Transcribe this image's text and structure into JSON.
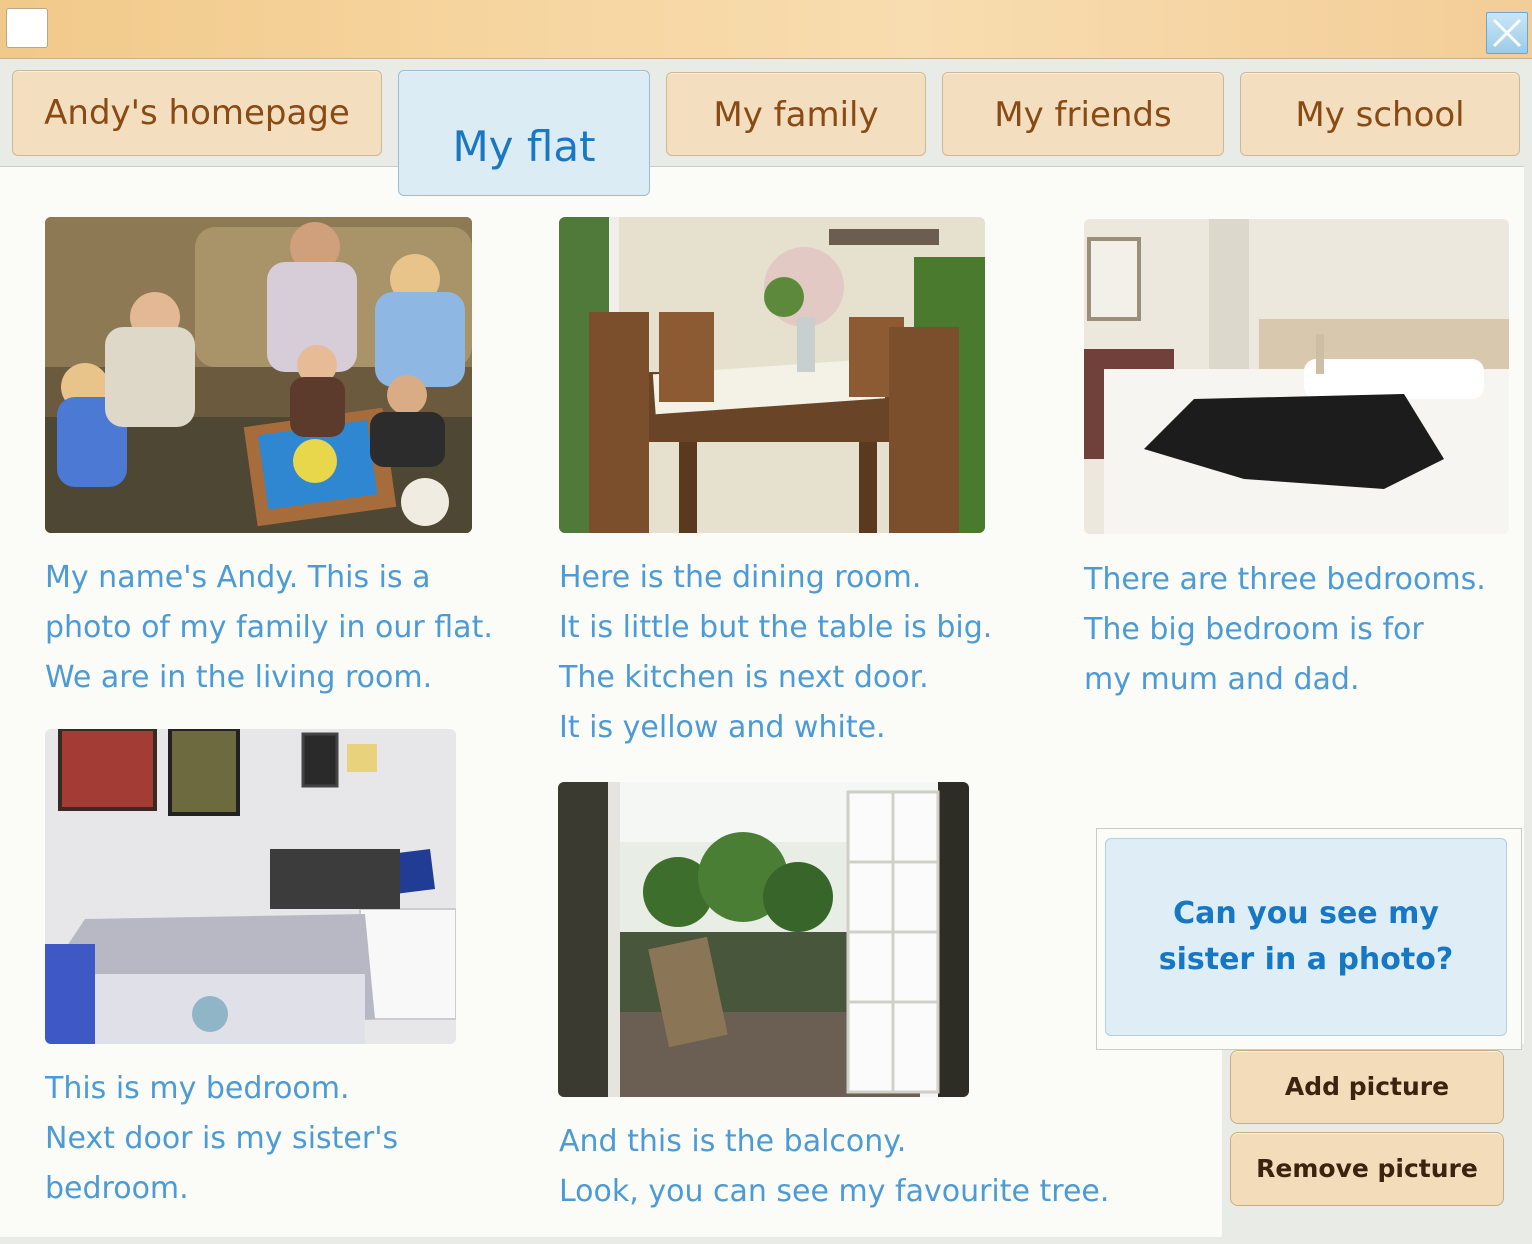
{
  "window": {
    "icon": "window-icon",
    "close_icon": "close-icon"
  },
  "tabs": [
    {
      "label": "Andy's homepage",
      "active": false
    },
    {
      "label": "My flat",
      "active": true
    },
    {
      "label": "My family",
      "active": false
    },
    {
      "label": "My friends",
      "active": false
    },
    {
      "label": "My school",
      "active": false
    }
  ],
  "photos": [
    {
      "subject": "family-living-room-photo",
      "caption": [
        "My name's Andy. This is a",
        "photo of my family in our flat.",
        "We are in the living room."
      ]
    },
    {
      "subject": "dining-room-photo",
      "caption": [
        "Here is the dining room.",
        "It is little but the table is big.",
        "The kitchen is next door.",
        "It is yellow and white."
      ]
    },
    {
      "subject": "parents-bedroom-photo",
      "caption": [
        "There are three bedrooms.",
        "The big bedroom is for",
        "my mum and dad."
      ]
    },
    {
      "subject": "andys-bedroom-photo",
      "caption": [
        "This is my bedroom.",
        "Next door is my sister's",
        "bedroom."
      ]
    },
    {
      "subject": "balcony-photo",
      "caption": [
        "And this is the balcony.",
        "Look, you can see my favourite tree."
      ]
    }
  ],
  "question": {
    "line1": "Can you see my",
    "line2": "sister in a photo?"
  },
  "actions": {
    "add_picture": "Add picture",
    "remove_picture": "Remove picture"
  },
  "colors": {
    "tab_bg": "#f3dfbf",
    "tab_text": "#8a4a14",
    "active_tab_bg": "#dcecf5",
    "active_tab_text": "#1a78c2",
    "caption_text": "#4d9bd4",
    "button_bg": "#f3dcba"
  }
}
